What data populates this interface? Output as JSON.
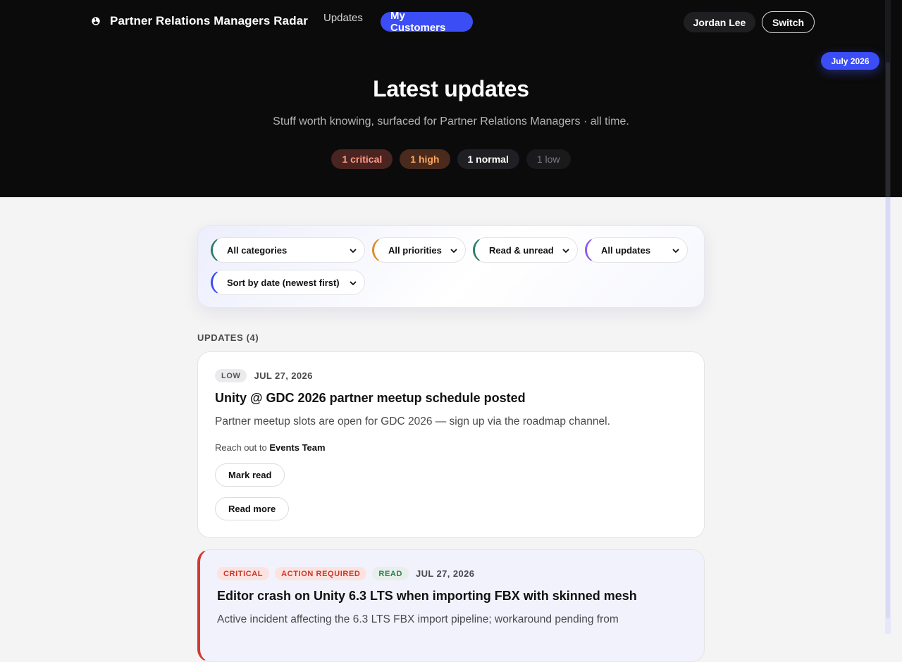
{
  "header": {
    "brand_icon": "radar-icon",
    "title": "Partner Relations Managers Radar",
    "nav": {
      "updates_label": "Updates",
      "customers_label": "My Customers"
    },
    "user_name": "Jordan Lee",
    "switch_label": "Switch",
    "month_badge": "July 2026"
  },
  "hero": {
    "title": "Latest updates",
    "subtitle": "Stuff worth knowing, surfaced for Partner Relations Managers · all time.",
    "pills": {
      "critical": "1 critical",
      "high": "1 high",
      "normal": "1 normal",
      "low": "1 low"
    }
  },
  "filters": {
    "category": "All categories",
    "priority": "All priorities",
    "read_state": "Read & unread",
    "scope": "All updates",
    "sort": "Sort by date (newest first)"
  },
  "list": {
    "heading": "UPDATES (4)",
    "items": [
      {
        "tags": [
          "LOW"
        ],
        "date": "JUL 27, 2026",
        "title": "Unity @ GDC 2026 partner meetup schedule posted",
        "summary": "Partner meetup slots are open for GDC 2026 — sign up via the roadmap channel.",
        "contact_prefix": "Reach out to",
        "contact_name": "Events Team",
        "mark_read_label": "Mark read",
        "read_more_label": "Read more"
      },
      {
        "tags": [
          "CRITICAL",
          "ACTION REQUIRED",
          "READ"
        ],
        "date": "JUL 27, 2026",
        "title": "Editor crash on Unity 6.3 LTS when importing FBX with skinned mesh",
        "summary": "Active incident affecting the 6.3 LTS FBX import pipeline; workaround pending from"
      }
    ]
  },
  "colors": {
    "accent": "#3b4df5",
    "critical": "#d33a2c",
    "hero_bg": "#0b0b0b"
  }
}
